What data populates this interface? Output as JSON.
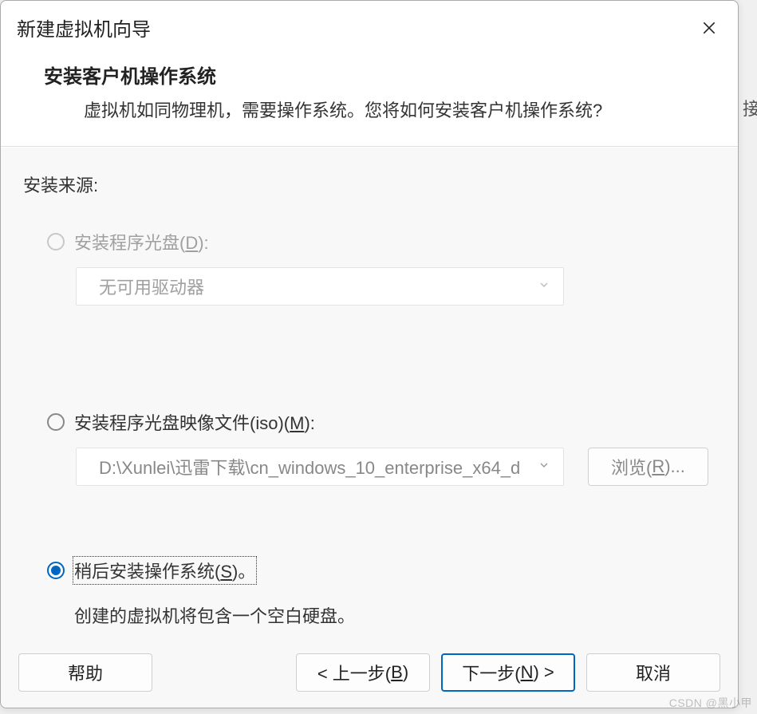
{
  "dialog": {
    "title": "新建虚拟机向导",
    "close_icon": "close-icon"
  },
  "header": {
    "heading": "安装客户机操作系统",
    "subtitle": "虚拟机如同物理机，需要操作系统。您将如何安装客户机操作系统?"
  },
  "content": {
    "source_label": "安装来源:",
    "option_disc": {
      "label_pre": "安装程序光盘(",
      "hotkey": "D",
      "label_post": "):",
      "enabled": false,
      "dropdown_text": "无可用驱动器"
    },
    "option_iso": {
      "label_pre": "安装程序光盘映像文件(iso)(",
      "hotkey": "M",
      "label_post": "):",
      "enabled": true,
      "selected": false,
      "path_value": "D:\\Xunlei\\迅雷下载\\cn_windows_10_enterprise_x64_d",
      "browse_label_pre": "浏览(",
      "browse_hotkey": "R",
      "browse_label_post": ")..."
    },
    "option_later": {
      "label_pre": "稍后安装操作系统(",
      "hotkey": "S",
      "label_post": ")。",
      "selected": true,
      "description": "创建的虚拟机将包含一个空白硬盘。"
    }
  },
  "footer": {
    "help": "帮助",
    "back_pre": "< 上一步(",
    "back_hotkey": "B",
    "back_post": ")",
    "next_pre": "下一步(",
    "next_hotkey": "N",
    "next_post": ") >",
    "cancel": "取消"
  },
  "background": {
    "edge_char": "接"
  },
  "watermark": "CSDN @黑小甲"
}
